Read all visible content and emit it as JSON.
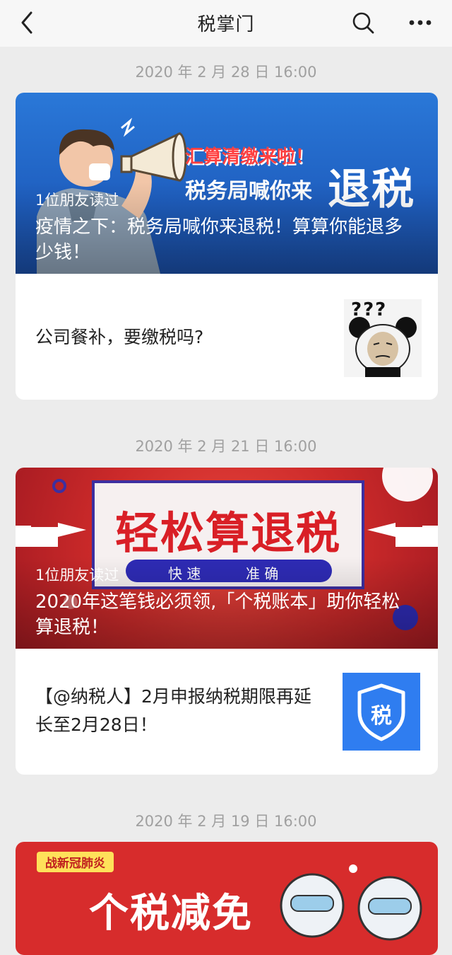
{
  "nav": {
    "title": "税掌门"
  },
  "feed": [
    {
      "date": "2020 年 2 月 28 日 16:00",
      "main": {
        "friends": "1位朋友读过",
        "headline": "疫情之下：税务局喊你来退税！算算你能退多少钱！",
        "banner_top": "汇算清缴来啦！",
        "banner_line": "税务局喊你来",
        "banner_big": "退税"
      },
      "sub": {
        "title": "公司餐补，要缴税吗?",
        "thumb_text": "???"
      }
    },
    {
      "date": "2020 年 2 月 21 日 16:00",
      "main": {
        "friends": "1位朋友读过",
        "headline": "2020年这笔钱必须领,「个税账本」助你轻松算退税！",
        "banner_big": "轻松算退税",
        "pill_left": "快 速",
        "pill_right": "准 确"
      },
      "sub": {
        "title": "【@纳税人】2月申报纳税期限再延长至2月28日！",
        "thumb_text": "税"
      }
    },
    {
      "date": "2020 年 2 月 19 日 16:00",
      "main": {
        "tag": "战新冠肺炎",
        "banner_big": "个税减免"
      }
    }
  ],
  "colors": {
    "background": "#ececec",
    "date": "#a0a0a0",
    "banner1": "#2a78d8",
    "banner2": "#cc2a2a",
    "banner3": "#d72c2c",
    "badge_blue": "#2f7df0"
  },
  "icons": [
    "chevron-left-icon",
    "search-icon",
    "more-icon",
    "megaphone-icon",
    "shield-tax-icon",
    "hand-pointer-icon"
  ]
}
